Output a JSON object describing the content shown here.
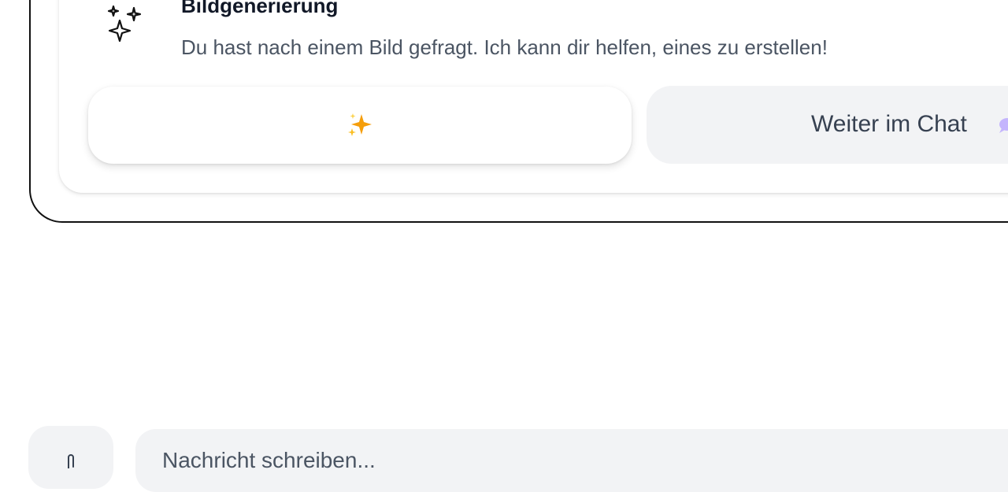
{
  "suggestion": {
    "title": "Bildgenerierung",
    "description": "Du hast nach einem Bild gefragt. Ich kann dir helfen, eines zu erstellen!",
    "icon": "sparkles-icon",
    "generate_button": {
      "label": "",
      "icon": "sparkles-emoji"
    },
    "continue_button": {
      "label": "Weiter im Chat",
      "icon": "speech-bubble-emoji"
    }
  },
  "composer": {
    "attach_icon": "paperclip-icon",
    "placeholder": "Nachricht schreiben..."
  },
  "colors": {
    "accent_sparkle": "#f59e0b",
    "button_gray": "#f2f3f5",
    "bubble_lavender": "#c4b5fd"
  }
}
